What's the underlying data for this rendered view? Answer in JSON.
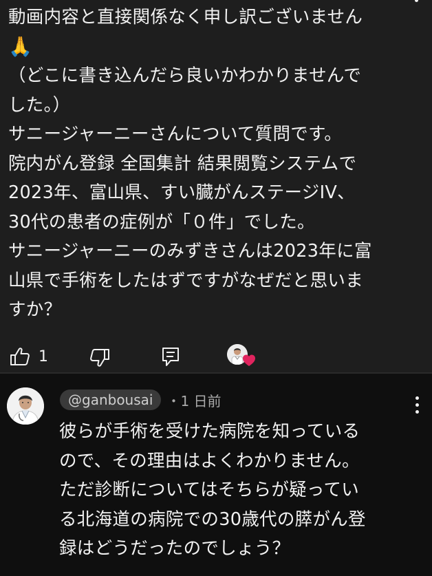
{
  "comment": {
    "lines": [
      "動画内容と直接関係なく申し訳ございません",
      "🙏",
      "（どこに書き込んだら良いかわかりませんで",
      "した。）",
      "サニージャーニーさんについて質問です。",
      "院内がん登録 全国集計 結果閲覧システムで",
      "2023年、富山県、すい臓がんステージIV、",
      "30代の患者の症例が「０件」でした。",
      "サニージャーニーのみずきさんは2023年に富",
      "山県で手術をしたはずですがなぜだと思いま",
      "すか？"
    ],
    "like_count": "1",
    "icons": {
      "like": "thumbs-up-icon",
      "dislike": "thumbs-down-icon",
      "reply": "reply-comment-icon",
      "creator_heart": "creator-heart-icon",
      "menu": "more-vert-icon"
    }
  },
  "reply": {
    "handle": "@ganbousai",
    "time": "・1 日前",
    "lines": [
      "彼らが手術を受けた病院を知っている",
      "ので、その理由はよくわかりません。",
      "ただ診断についてはそちらが疑ってい",
      "る北海道の病院での30歳代の膵がん登",
      "録はどうだったのでしょう？"
    ],
    "icons": {
      "avatar": "doctor-avatar",
      "menu": "more-vert-icon"
    }
  },
  "colors": {
    "background": "#0f0f0f",
    "comment_bg": "#1e1e1e",
    "text": "#f1f1f1",
    "handle_chip": "#3a3a3a",
    "heart": "#e0245e"
  }
}
